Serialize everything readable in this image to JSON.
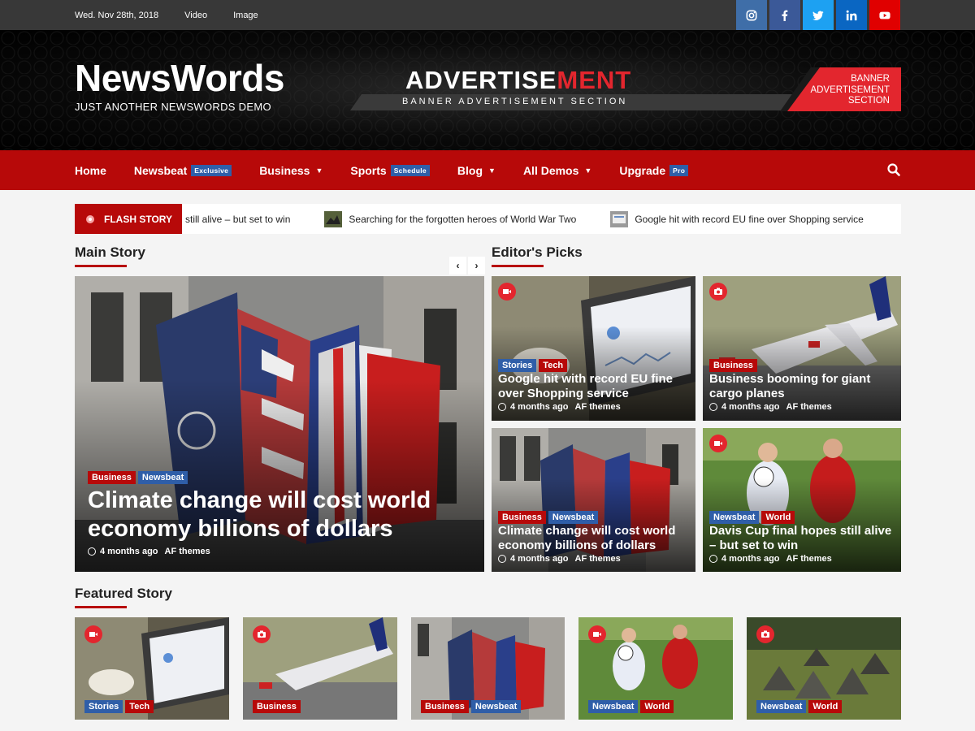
{
  "topbar": {
    "date": "Wed. Nov 28th, 2018",
    "links": [
      "Video",
      "Image"
    ],
    "social": [
      {
        "icon": "instagram-icon",
        "color": "#3f6ea8"
      },
      {
        "icon": "facebook-icon",
        "color": "#3b5998"
      },
      {
        "icon": "twitter-icon",
        "color": "#1da1f2"
      },
      {
        "icon": "linkedin-icon",
        "color": "#0a66c2"
      },
      {
        "icon": "youtube-icon",
        "color": "#e00000"
      }
    ]
  },
  "header": {
    "site_title": "NewsWords",
    "tagline": "JUST ANOTHER NEWSWORDS DEMO",
    "ad_title_white": "ADVERTISE",
    "ad_title_red": "MENT",
    "ad_subtitle": "BANNER ADVERTISEMENT SECTION",
    "ad_box": "BANNER ADVERTISEMENT SECTION"
  },
  "nav": {
    "home": "Home",
    "newsbeat": "Newsbeat",
    "newsbeat_badge": "Exclusive",
    "business": "Business",
    "sports": "Sports",
    "sports_badge": "Schedule",
    "blog": "Blog",
    "all_demos": "All Demos",
    "upgrade": "Upgrade",
    "upgrade_badge": "Pro"
  },
  "flash": {
    "label": "FLASH STORY",
    "items": [
      "still alive – but set to win",
      "Searching for the forgotten heroes of World War Two",
      "Google hit with record EU fine over Shopping service"
    ]
  },
  "sections": {
    "main_story": "Main Story",
    "editors_picks": "Editor's Picks",
    "featured_story": "Featured Story"
  },
  "main_story": {
    "tags": [
      "Business",
      "Newsbeat"
    ],
    "title": "Climate change will cost world economy billions of dollars",
    "time": "4 months ago",
    "author": "AF themes"
  },
  "editors_picks": [
    {
      "tags": [
        "Stories",
        "Tech"
      ],
      "title": "Google hit with record EU fine over Shopping service",
      "time": "4 months ago",
      "author": "AF themes",
      "media": "video"
    },
    {
      "tags": [
        "Business"
      ],
      "title": "Business booming for giant cargo planes",
      "time": "4 months ago",
      "author": "AF themes",
      "media": "camera"
    },
    {
      "tags": [
        "Business",
        "Newsbeat"
      ],
      "title": "Climate change will cost world economy billions of dollars",
      "time": "4 months ago",
      "author": "AF themes",
      "media": ""
    },
    {
      "tags": [
        "Newsbeat",
        "World"
      ],
      "title": "Davis Cup final hopes still alive – but set to win",
      "time": "4 months ago",
      "author": "AF themes",
      "media": "video"
    }
  ],
  "featured": [
    {
      "tags": [
        "Stories",
        "Tech"
      ],
      "media": "video"
    },
    {
      "tags": [
        "Business"
      ],
      "media": "camera"
    },
    {
      "tags": [
        "Business",
        "Newsbeat"
      ],
      "media": ""
    },
    {
      "tags": [
        "Newsbeat",
        "World"
      ],
      "media": "video"
    },
    {
      "tags": [
        "Newsbeat",
        "World"
      ],
      "media": "camera"
    }
  ]
}
